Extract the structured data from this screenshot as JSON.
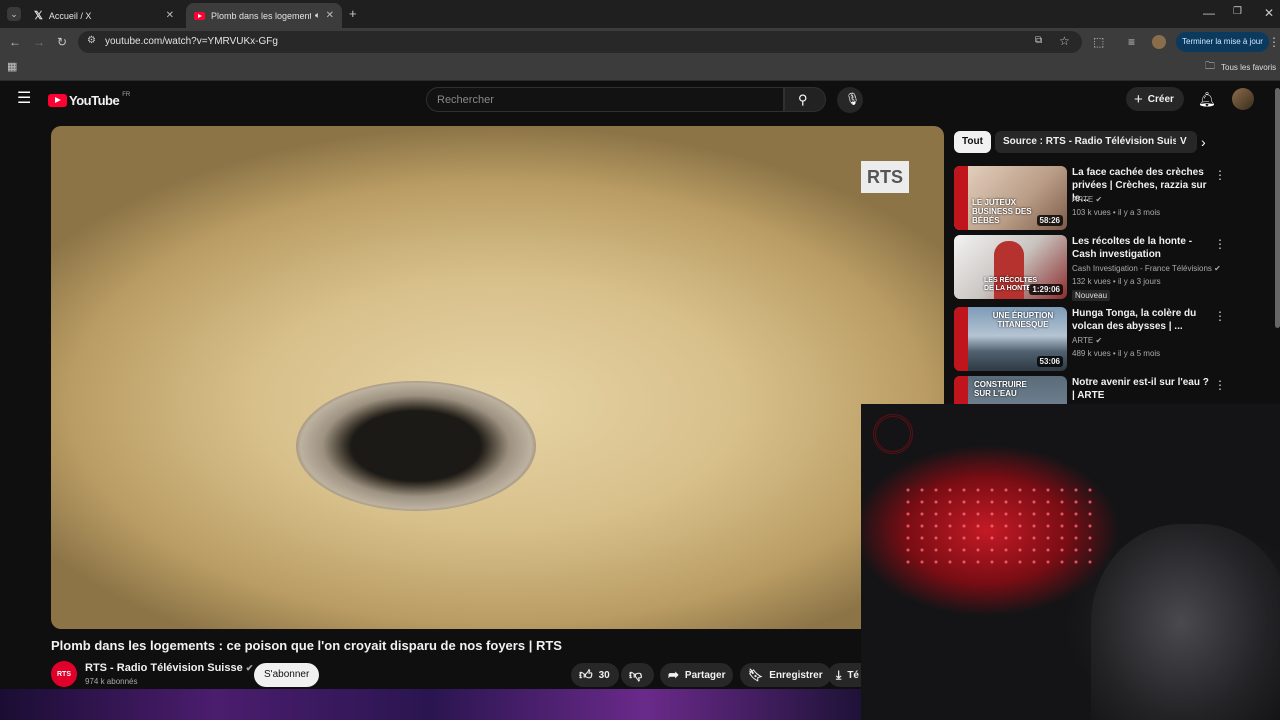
{
  "browser": {
    "tabs": [
      {
        "title": "Accueil / X",
        "icon": "x-logo"
      },
      {
        "title": "Plomb dans les logements",
        "icon": "youtube-favicon"
      }
    ],
    "url": "youtube.com/watch?v=YMRVUKx-GFg",
    "update_label": "Terminer la mise à jour",
    "bookmarks_all": "Tous les favoris"
  },
  "youtube": {
    "logo": "YouTube",
    "region": "FR",
    "search_placeholder": "Rechercher",
    "create_label": "Créer"
  },
  "video": {
    "overlay_logo": "RTS",
    "title": "Plomb dans les logements : ce poison que l'on croyait disparu de nos foyers | RTS",
    "channel": "RTS - Radio Télévision Suisse",
    "channel_avatar_text": "RTS",
    "subscribers": "974 k abonnés",
    "subscribe_label": "S'abonner",
    "likes": "30",
    "share_label": "Partager",
    "save_label": "Enregistrer",
    "download_label_partial": "Té"
  },
  "sidebar": {
    "chips": [
      "Tout",
      "Source : RTS - Radio Télévision Suisse",
      "V"
    ],
    "recommendations": [
      {
        "title": "La face cachée des crèches privées | Crèches, razzia sur le...",
        "channel": "ARTE",
        "meta": "103 k vues • il y a 3 mois",
        "duration": "58:26",
        "thumb_caption": "LE JUTEUX BUSINESS DES BÉBÉS",
        "verified": true
      },
      {
        "title": "Les récoltes de la honte - Cash investigation",
        "channel": "Cash Investigation - France Télévisions",
        "meta": "132 k vues • il y a 3 jours",
        "duration": "1:29:06",
        "thumb_caption": "LES RÉCOLTES DE LA HONTE",
        "badge": "Nouveau",
        "verified": true
      },
      {
        "title": "Hunga Tonga, la colère du volcan des abysses | ...",
        "channel": "ARTE",
        "meta": "489 k vues • il y a 5 mois",
        "duration": "53:06",
        "thumb_caption": "UNE ÉRUPTION TITANESQUE",
        "verified": true
      },
      {
        "title": "Notre avenir est-il sur l'eau ? | ARTE",
        "channel": "",
        "meta": "",
        "duration": "",
        "thumb_caption": "CONSTRUIRE SUR L'EAU"
      }
    ]
  },
  "colors": {
    "yt_red": "#ff0033",
    "rts_red": "#e1002a",
    "bg": "#0f0f0f",
    "update_button": "#0b3a5e"
  }
}
